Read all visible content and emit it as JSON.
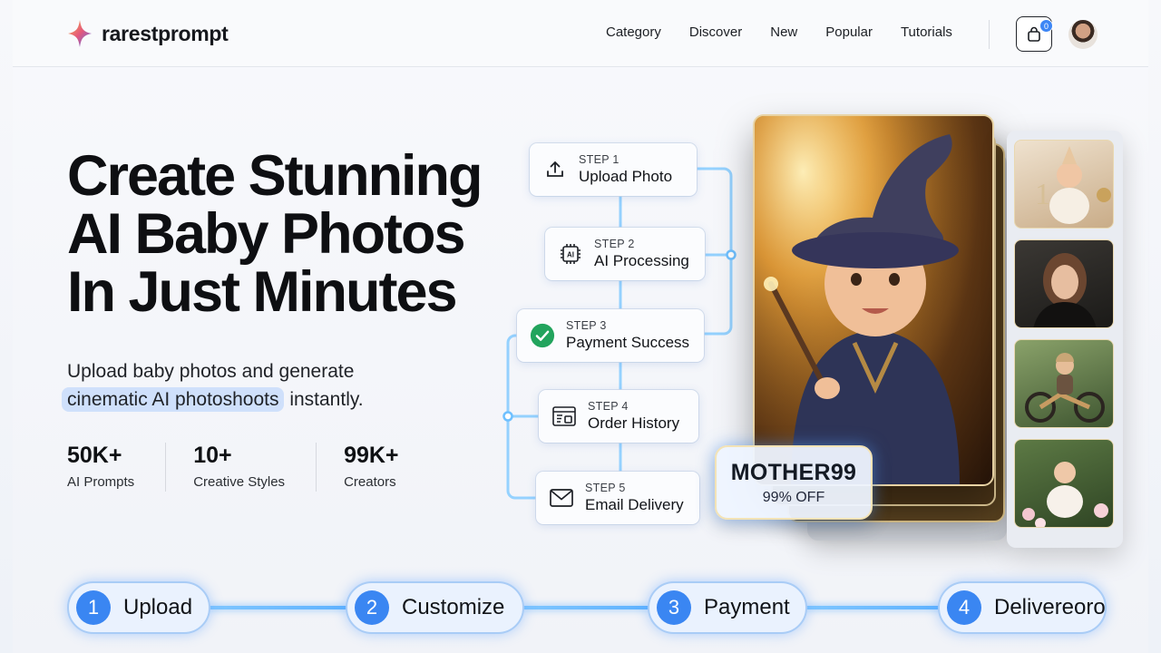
{
  "brand": {
    "name": "rarestprompt"
  },
  "nav": {
    "items": [
      "Category",
      "Discover",
      "New",
      "Popular",
      "Tutorials"
    ]
  },
  "cart": {
    "count": "0"
  },
  "hero": {
    "title_lines": [
      "Create Stunning",
      "AI Baby Photos",
      "In Just Minutes"
    ],
    "subtitle_line1": "Upload baby photos and generate",
    "subtitle_highlight": "cinematic AI photoshoots",
    "subtitle_rest": " instantly."
  },
  "stats": [
    {
      "value": "50K+",
      "label": "AI Prompts"
    },
    {
      "value": "10+",
      "label": "Creative Styles"
    },
    {
      "value": "99K+",
      "label": "Creators"
    }
  ],
  "steps": [
    {
      "kicker": "STEP 1",
      "label": "Upload Photo",
      "icon": "upload-icon"
    },
    {
      "kicker": "STEP 2",
      "label": "AI Processing",
      "icon": "ai-chip-icon"
    },
    {
      "kicker": "STEP 3",
      "label": "Payment Success",
      "icon": "check-circle-icon"
    },
    {
      "kicker": "STEP 4",
      "label": "Order History",
      "icon": "history-icon"
    },
    {
      "kicker": "STEP 5",
      "label": "Email Delivery",
      "icon": "mail-icon"
    }
  ],
  "promo": {
    "code": "MOTHER99",
    "discount": "99% OFF"
  },
  "process": [
    {
      "num": "1",
      "label": "Upload"
    },
    {
      "num": "2",
      "label": "Customize"
    },
    {
      "num": "3",
      "label": "Payment"
    },
    {
      "num": "4",
      "label": "Delivereoro"
    }
  ],
  "colors": {
    "accent": "#3a86f2",
    "highlight": "#cfe0fb",
    "connector": "#6fc0ff",
    "check": "#22a45d"
  }
}
